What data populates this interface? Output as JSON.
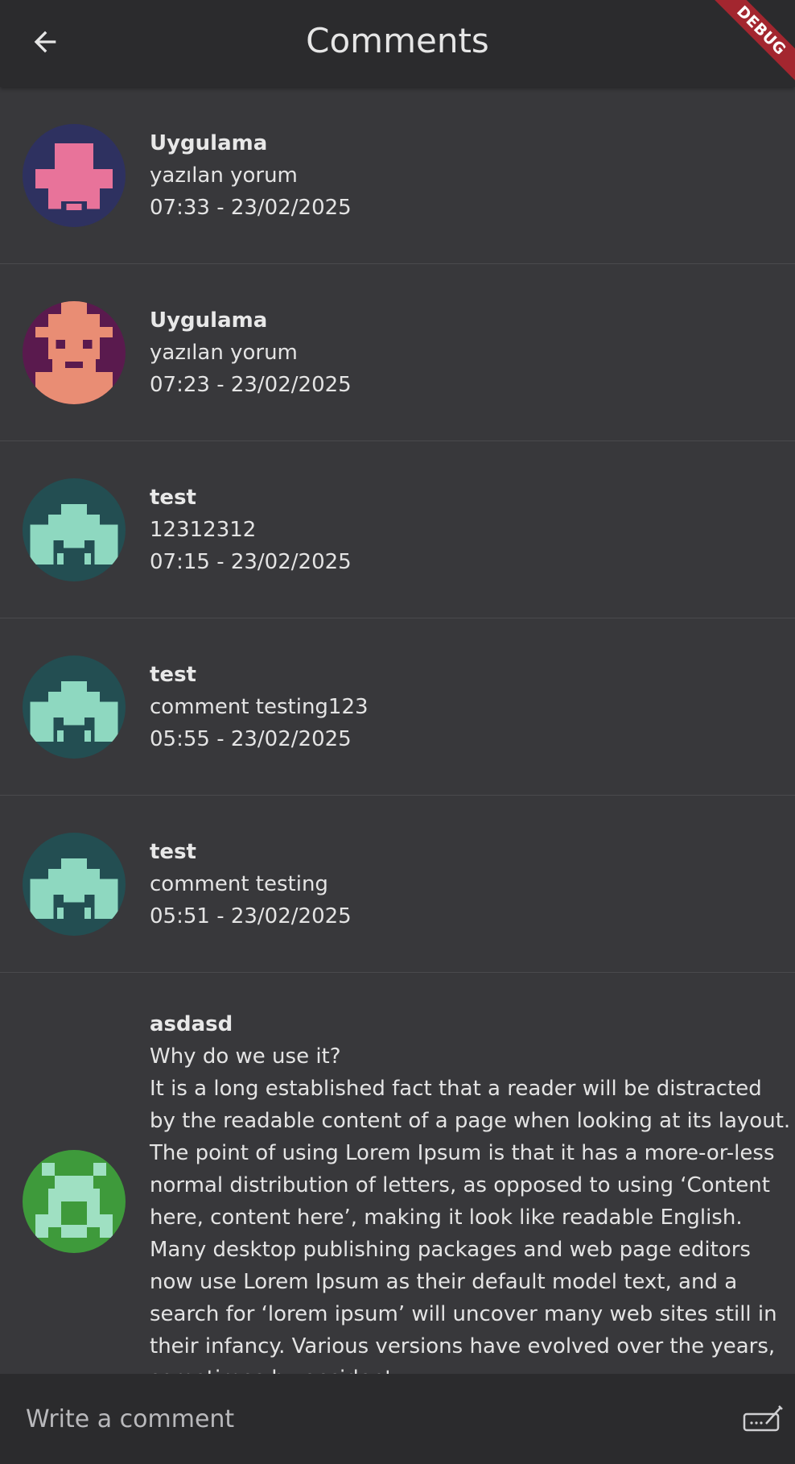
{
  "appbar": {
    "title": "Comments",
    "back_icon": "arrow-back-icon"
  },
  "debug_banner": "DEBUG",
  "comments": [
    {
      "author": "Uygulama",
      "text": "yazılan yorum",
      "time": "07:33 - 23/02/2025",
      "avatar": {
        "bg": "#2e3160",
        "fg": "#e8739a"
      }
    },
    {
      "author": "Uygulama",
      "text": "yazılan yorum",
      "time": "07:23 - 23/02/2025",
      "avatar": {
        "bg": "#5a1a4e",
        "fg": "#e98d74"
      }
    },
    {
      "author": "test",
      "text": "12312312",
      "time": "07:15 - 23/02/2025",
      "avatar": {
        "bg": "#234e52",
        "fg": "#8ed8c0"
      }
    },
    {
      "author": "test",
      "text": "comment testing123",
      "time": "05:55 - 23/02/2025",
      "avatar": {
        "bg": "#234e52",
        "fg": "#8ed8c0"
      }
    },
    {
      "author": "test",
      "text": "comment testing",
      "time": "05:51 - 23/02/2025",
      "avatar": {
        "bg": "#234e52",
        "fg": "#8ed8c0"
      }
    },
    {
      "author": "asdasd",
      "text": "Why do we use it?\nIt is a long established fact that a reader will be distracted by the readable content of a page when looking at its layout. The point of using Lorem Ipsum is that it has a more-or-less normal distribution of letters, as opposed to using ‘Content here, content here’, making it look like readable English. Many desktop publishing packages and web page editors now use Lorem Ipsum as their default model text, and a search for ‘lorem ipsum’ will uncover many web sites still in their infancy. Various versions have evolved over the years, sometimes by accident.",
      "time": "",
      "avatar": {
        "bg": "#3e9a3b",
        "fg": "#9fe0c2"
      }
    }
  ],
  "input": {
    "placeholder": "Write a comment",
    "send_icon": "keyboard-send-icon"
  }
}
